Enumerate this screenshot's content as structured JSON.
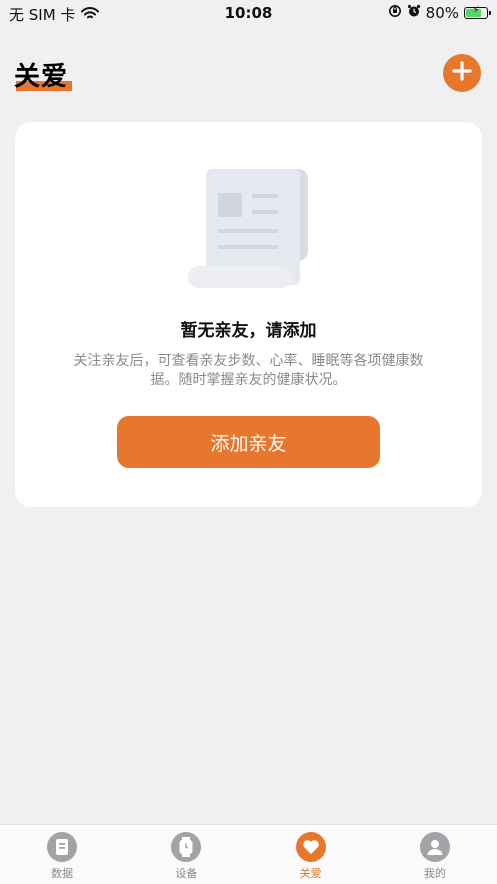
{
  "status_bar": {
    "carrier": "无 SIM 卡",
    "time": "10:08",
    "battery_percent": "80%",
    "battery_level": 0.8
  },
  "header": {
    "title": "关爱",
    "add_icon": "plus-icon"
  },
  "empty_state": {
    "illustration": "document-scroll-icon",
    "title": "暂无亲友，请添加",
    "description": "关注亲友后，可查看亲友步数、心率、睡眠等各项健康数据。随时掌握亲友的健康状况。",
    "button_label": "添加亲友"
  },
  "tabbar": {
    "items": [
      {
        "label": "数据",
        "icon": "data-icon",
        "active": false
      },
      {
        "label": "设备",
        "icon": "watch-icon",
        "active": false
      },
      {
        "label": "关爱",
        "icon": "heart-icon",
        "active": true
      },
      {
        "label": "我的",
        "icon": "profile-icon",
        "active": false
      }
    ]
  },
  "colors": {
    "accent": "#e8772e",
    "background": "#f0f0f2",
    "card": "#ffffff",
    "muted_text": "#8a8a8e",
    "tab_inactive": "#a3a3a7"
  }
}
